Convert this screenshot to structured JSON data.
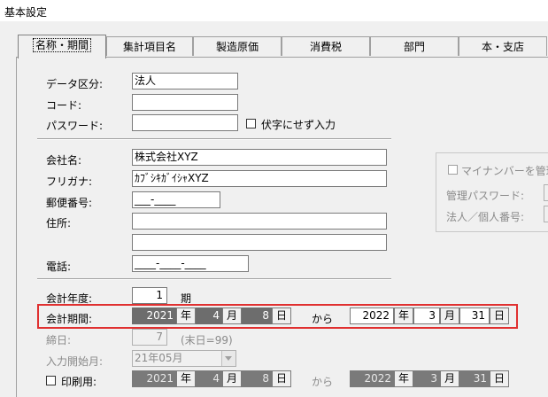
{
  "window": {
    "title": "基本設定"
  },
  "tabs": [
    "名称・期間",
    "集計項目名",
    "製造原価",
    "消費税",
    "部門",
    "本・支店"
  ],
  "fields": {
    "data_kubun": {
      "label": "データ区分:",
      "value": "法人"
    },
    "code": {
      "label": "コード:",
      "value": ""
    },
    "password": {
      "label": "パスワード:",
      "value": ""
    },
    "mask_checkbox": "伏字にせず入力",
    "company_name": {
      "label": "会社名:",
      "value": "株式会社XYZ"
    },
    "furigana": {
      "label": "フリガナ:",
      "value": "ｶﾌﾞｼｷｶﾞｲｼｬXYZ"
    },
    "postal": {
      "label": "郵便番号:",
      "value": "___-____"
    },
    "address": {
      "label": "住所:",
      "value1": "",
      "value2": ""
    },
    "phone": {
      "label": "電話:",
      "value": "____-____-____"
    }
  },
  "mynumber": {
    "checkbox": "マイナンバーを管理",
    "admin_password": "管理パスワード:",
    "corp_number": "法人／個人番号:"
  },
  "fiscal": {
    "year": {
      "label": "会計年度:",
      "value": "1",
      "unit": "期"
    },
    "period": {
      "label": "会計期間:",
      "start_y": "2021",
      "start_m": "4",
      "start_d": "8",
      "end_y": "2022",
      "end_m": "3",
      "end_d": "31",
      "sep": "から"
    },
    "closing": {
      "label": "締日:",
      "value": "7",
      "note": "(末日=99)"
    },
    "input_start": {
      "label": "入力開始月:",
      "value": "21年05月"
    },
    "print_period": {
      "label": "印刷用:",
      "start_y": "2021",
      "start_m": "4",
      "start_d": "8",
      "end_y": "2022",
      "end_m": "3",
      "end_d": "31",
      "sep": "から"
    },
    "units": {
      "y": "年",
      "m": "月",
      "d": "日"
    }
  }
}
